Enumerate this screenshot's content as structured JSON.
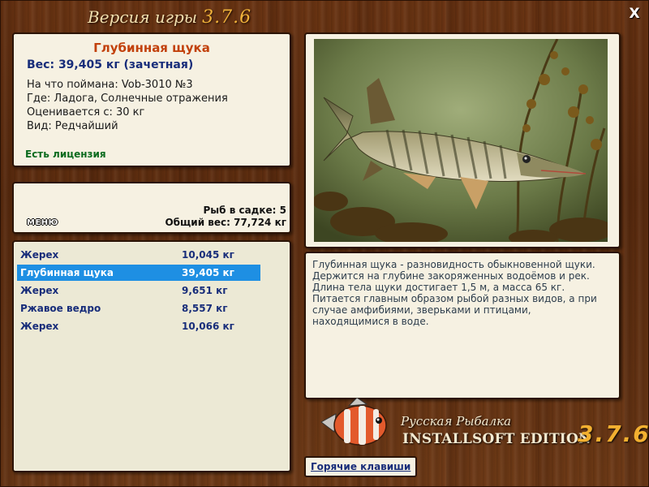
{
  "window": {
    "title": "Версия игры",
    "version": "3.7.6",
    "close_label": "X"
  },
  "fish_info": {
    "name": "Глубинная щука",
    "weight": "Вес: 39,405 кг (зачетная)",
    "lines": [
      "На что поймана: Vob-3010 №3",
      "Где: Ладога, Солнечные отражения",
      "Оценивается с: 30 кг",
      "Вид: Редчайший"
    ],
    "license": "Есть лицензия"
  },
  "keep_net": {
    "menu_label": "МЕНЮ",
    "count": "Рыб в садке: 5",
    "total_weight": "Общий вес: 77,724 кг"
  },
  "catch_list": [
    {
      "name": "Жерех",
      "weight": "10,045 кг",
      "selected": false
    },
    {
      "name": "Глубинная щука",
      "weight": "39,405 кг",
      "selected": true
    },
    {
      "name": "Жерех",
      "weight": "9,651 кг",
      "selected": false
    },
    {
      "name": "Ржавое ведро",
      "weight": "8,557 кг",
      "selected": false
    },
    {
      "name": "Жерех",
      "weight": "10,066 кг",
      "selected": false
    }
  ],
  "description": "Глубинная щука - разновидность обыкновенной щуки. Держится на глубине закоряженных водоёмов и рек. Длина тела щуки достигает 1,5 м, а масса 65 кг. Питается главным образом рыбой разных видов, а при случае амфибиями, зверьками и птицами, находящимися в воде.",
  "edition": {
    "subtitle": "Русская Рыбалка",
    "name": "INSTALLSOFT EDITION",
    "version": "3.7.6"
  },
  "hotkeys_label": "Горячие клавиши",
  "icons": {
    "close": "close-icon",
    "logo": "fish-logo-icon"
  },
  "colors": {
    "panel": "#f6f1e2",
    "fish_name": "#c2410c",
    "list_text": "#182d7a",
    "selection": "#1e8fe3",
    "license": "#0a6b1e",
    "version_accent": "#f0b23a"
  }
}
